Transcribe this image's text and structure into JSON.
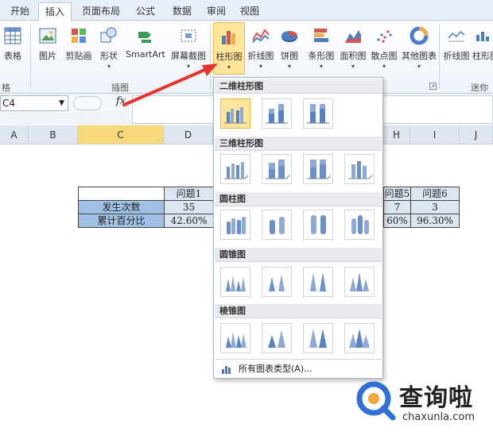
{
  "tabs": [
    "开始",
    "插入",
    "页面布局",
    "公式",
    "数据",
    "审阅",
    "视图"
  ],
  "active_tab": "插入",
  "ribbon": {
    "buttons": [
      "表格",
      "图片",
      "剪贴画",
      "形状",
      "SmartArt",
      "屏幕截图",
      "柱形图",
      "折线图",
      "饼图",
      "条形图",
      "面积图",
      "散点图",
      "其他图表",
      "折线图",
      "柱形图"
    ],
    "groups": [
      "格",
      "插图",
      "迷你"
    ]
  },
  "formula_bar": {
    "name_box": "C4",
    "fx": "fx"
  },
  "sheet": {
    "col_headers": [
      "A",
      "B",
      "C",
      "D",
      "H",
      "I",
      "J"
    ],
    "row1": [
      "",
      "问题1",
      "问题5",
      "问题6"
    ],
    "row2": [
      "发生次数",
      "35",
      "7",
      "3"
    ],
    "row3": [
      "累计百分比",
      "42.60%",
      "60%",
      "96.30%"
    ]
  },
  "dropdown": {
    "sections": [
      "二维柱形图",
      "三维柱形图",
      "圆柱图",
      "圆锥图",
      "棱锥图"
    ],
    "footer": "所有图表类型(A)..."
  },
  "watermark": {
    "name": "查询啦",
    "url": "chaxunla.com"
  }
}
